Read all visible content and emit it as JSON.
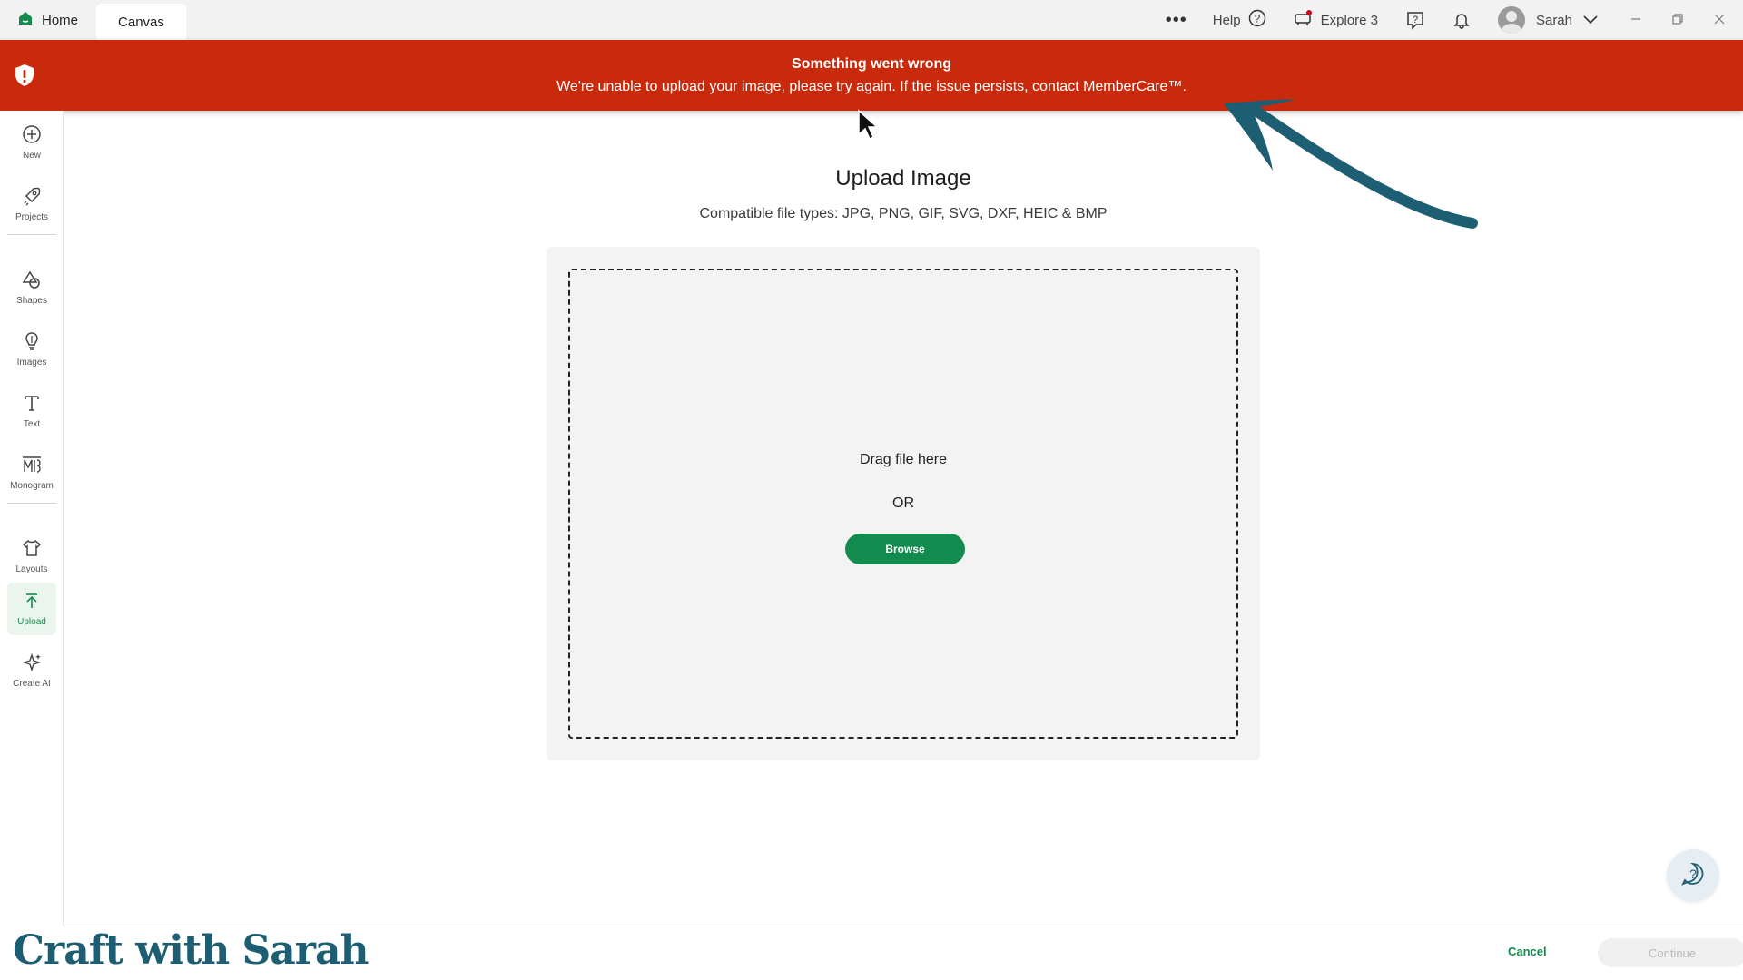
{
  "tabs": {
    "home": "Home",
    "canvas": "Canvas"
  },
  "topbar": {
    "help": "Help",
    "explore": "Explore 3",
    "user": "Sarah"
  },
  "banner": {
    "title": "Something went wrong",
    "message": "We're unable to upload your image, please try again. If the issue persists, contact MemberCare™."
  },
  "sidebar": {
    "items": [
      {
        "label": "New",
        "icon": "plus-circle-icon"
      },
      {
        "label": "Projects",
        "icon": "rocket-icon"
      },
      {
        "label": "Shapes",
        "icon": "shapes-icon"
      },
      {
        "label": "Images",
        "icon": "lightbulb-icon"
      },
      {
        "label": "Text",
        "icon": "text-icon"
      },
      {
        "label": "Monogram",
        "icon": "monogram-icon"
      },
      {
        "label": "Layouts",
        "icon": "shirt-icon"
      },
      {
        "label": "Upload",
        "icon": "upload-icon"
      },
      {
        "label": "Create AI",
        "icon": "sparkle-icon"
      }
    ]
  },
  "upload": {
    "title": "Upload Image",
    "subtitle": "Compatible file types:  JPG, PNG, GIF, SVG, DXF, HEIC & BMP",
    "drag": "Drag file here",
    "or": "OR",
    "browse": "Browse"
  },
  "footer": {
    "cancel": "Cancel",
    "continue": "Continue"
  },
  "watermark": "Craft with Sarah",
  "colors": {
    "brand_green": "#128c4e",
    "error_red": "#c92a0b",
    "annotation_arrow": "#1d5e73"
  }
}
